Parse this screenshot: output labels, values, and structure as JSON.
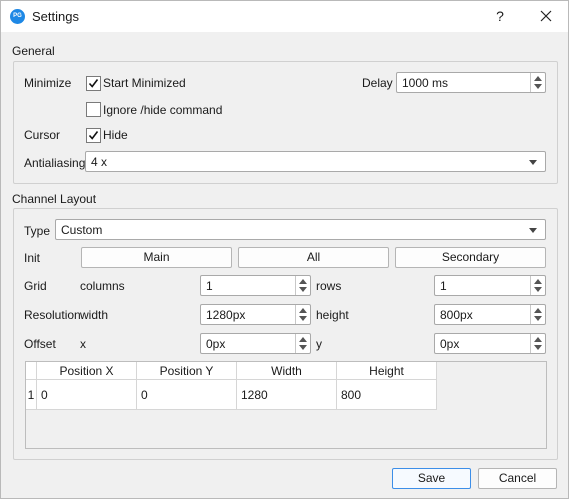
{
  "window": {
    "title": "Settings",
    "help": "?",
    "app_icon_text": "PG"
  },
  "general": {
    "section_label": "General",
    "minimize_label": "Minimize",
    "start_minimized_label": "Start Minimized",
    "start_minimized_checked": true,
    "delay_label": "Delay",
    "delay_value": "1000 ms",
    "ignore_hide_label": "Ignore /hide command",
    "ignore_hide_checked": false,
    "cursor_label": "Cursor",
    "hide_label": "Hide",
    "hide_checked": true,
    "antialiasing_label": "Antialiasing",
    "antialiasing_value": "4 x"
  },
  "channel": {
    "section_label": "Channel Layout",
    "type_label": "Type",
    "type_value": "Custom",
    "init_label": "Init",
    "init_buttons": [
      "Main",
      "All",
      "Secondary"
    ],
    "grid_label": "Grid",
    "columns_label": "columns",
    "columns_value": "1",
    "rows_label": "rows",
    "rows_value": "1",
    "resolution_label": "Resolution",
    "width_label": "width",
    "width_value": "1280px",
    "height_label": "height",
    "height_value": "800px",
    "offset_label": "Offset",
    "x_label": "x",
    "x_value": "0px",
    "y_label": "y",
    "y_value": "0px",
    "table": {
      "headers": [
        "Position X",
        "Position Y",
        "Width",
        "Height"
      ],
      "rows": [
        {
          "index": "1",
          "cells": [
            "0",
            "0",
            "1280",
            "800"
          ]
        }
      ]
    }
  },
  "footer": {
    "save_label": "Save",
    "cancel_label": "Cancel"
  },
  "colors": {
    "accent": "#3c8ee8",
    "icon": "#1e88e5"
  }
}
